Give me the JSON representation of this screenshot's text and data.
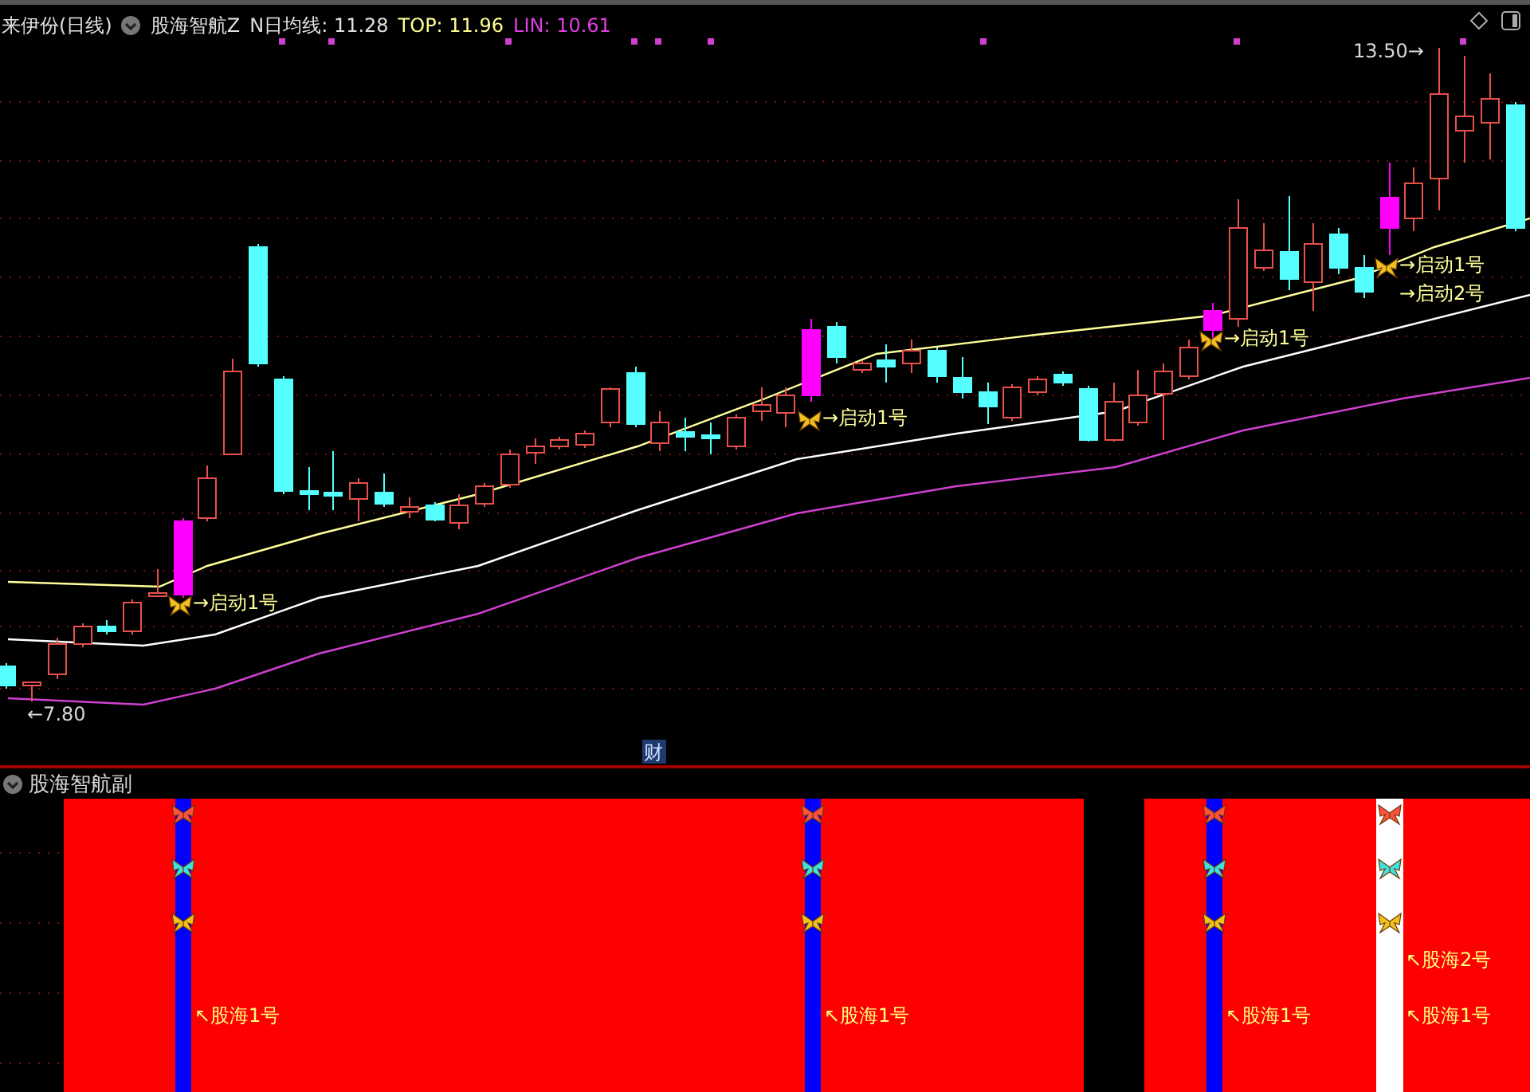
{
  "header": {
    "stock": "来伊份(日线)",
    "indicator": "股海智航Z",
    "ma_label": "N日均线: 11.28",
    "top_label": "TOP: 11.96",
    "lin_label": "LIN: 10.61"
  },
  "main_chart": {
    "high_label": "13.50→",
    "low_label": "←7.80",
    "finance_marker": "财",
    "signals": [
      {
        "text": "→启动1号"
      },
      {
        "text": "→启动1号"
      },
      {
        "text": "→启动1号"
      },
      {
        "text": "→启动1号"
      },
      {
        "text": "→启动2号"
      }
    ]
  },
  "sub_pane": {
    "title": "股海智航副",
    "stripes": [
      {
        "color": "#0000ff"
      },
      {
        "color": "#0000ff"
      },
      {
        "color": "#0000ff"
      },
      {
        "color": "#ffffff"
      }
    ],
    "labels": [
      {
        "text": "↖股海1号"
      },
      {
        "text": "↖股海1号"
      },
      {
        "text": "↖股海1号"
      },
      {
        "text": "↖股海2号"
      },
      {
        "text": "↖股海1号"
      }
    ]
  }
}
